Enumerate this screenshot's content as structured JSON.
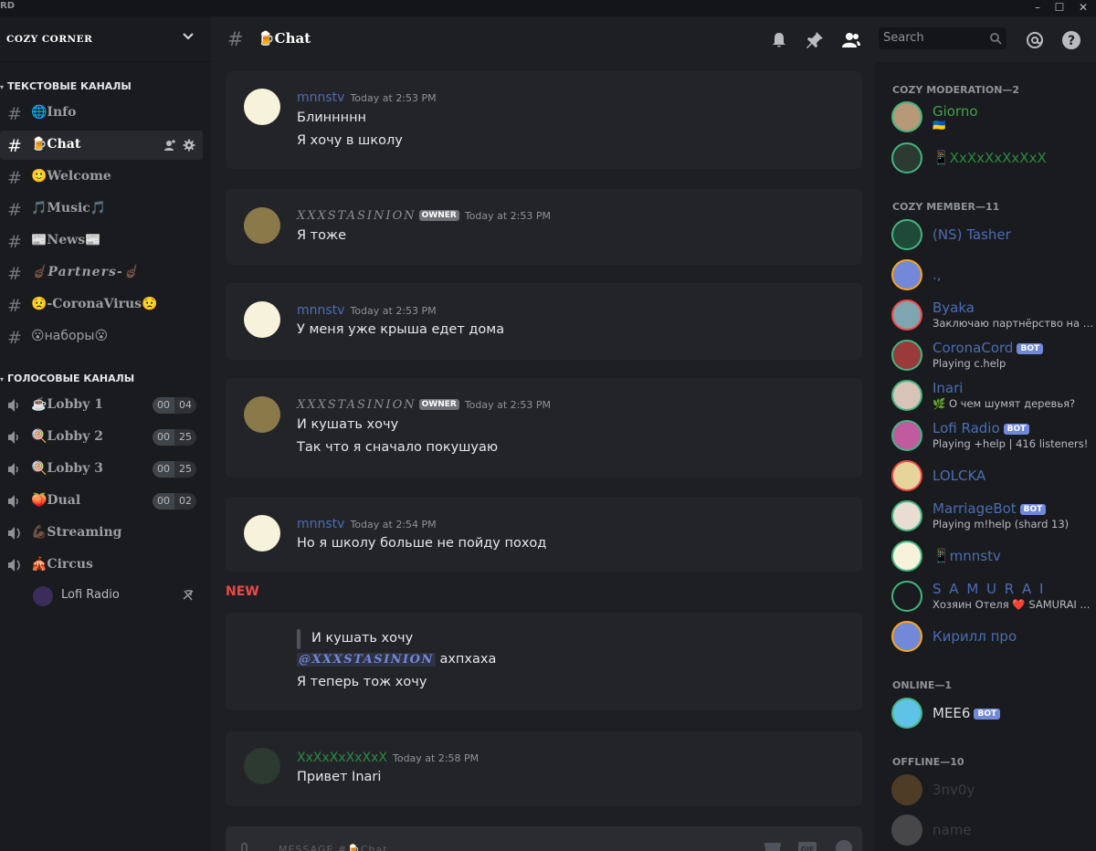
{
  "titlebar": {
    "brand": "RD"
  },
  "server": {
    "name": "COZY CORNER"
  },
  "sidebar": {
    "text_category": "ТЕКСТОВЫЕ КАНАЛЫ",
    "voice_category": "ГОЛОСОВЫЕ КАНАЛЫ",
    "text_channels": [
      {
        "label": "🌐Info"
      },
      {
        "label": "🍺Chat"
      },
      {
        "label": "🙂Welcome"
      },
      {
        "label": "🎵Music🎵"
      },
      {
        "label": "📰News📰"
      },
      {
        "label": "☝🏿Partners-☝🏿"
      },
      {
        "label": "😟-CoronaVirus😟"
      },
      {
        "label": "😮наборы😮"
      }
    ],
    "voice_channels": [
      {
        "label": "☕Lobby 1",
        "count_a": "00",
        "count_b": "04"
      },
      {
        "label": "🍭Lobby 2",
        "count_a": "00",
        "count_b": "25"
      },
      {
        "label": "🍭Lobby 3",
        "count_a": "00",
        "count_b": "25"
      },
      {
        "label": "🍑Dual",
        "count_a": "00",
        "count_b": "02"
      },
      {
        "label": "💪🏿Streaming"
      },
      {
        "label": "🎪Circus"
      }
    ],
    "voice_user": "Lofi Radio"
  },
  "header": {
    "channel": "🍺Chat",
    "search_placeholder": "Search"
  },
  "messages": [
    {
      "user": "mnnstv",
      "time": "Today at 2:53 PM",
      "lines": [
        "Блиннннн",
        "Я хочу в школу"
      ]
    },
    {
      "user": "XXXSTASINION",
      "badge": "OWNER",
      "time": "Today at 2:53 PM",
      "lines": [
        "Я тоже"
      ]
    },
    {
      "user": "mnnstv",
      "time": "Today at 2:53 PM",
      "lines": [
        "У меня уже крыша едет дома"
      ]
    },
    {
      "user": "XXXSTASINION",
      "badge": "OWNER",
      "time": "Today at 2:53 PM",
      "lines": [
        "И кушать хочу",
        "Так что я сначало покушуаю"
      ]
    },
    {
      "user": "mnnstv",
      "time": "Today at 2:54 PM",
      "lines": [
        "Но я школу больше не пойду поход"
      ]
    },
    {
      "quote": "И кушать хочу",
      "mention": "@XXXSTASINION",
      "after_mention": "ахпхаха",
      "lines": [
        "Я теперь тож хочу"
      ]
    },
    {
      "user": "XxXxXxXxXxX",
      "time": "Today at 2:58 PM",
      "lines": [
        "Привет Inari"
      ]
    }
  ],
  "new_divider": "NEW",
  "composer": {
    "placeholder": "MESSAGE #🍺Chat"
  },
  "members": {
    "groups": [
      {
        "title": "COZY MODERATION—2"
      },
      {
        "title": "COZY MEMBER—11"
      },
      {
        "title": "ONLINE—1"
      },
      {
        "title": "OFFLINE—10"
      }
    ],
    "list": [
      {
        "name": "Giorno",
        "status": "🇺🇦"
      },
      {
        "name": "📱XxXxXxXxXxX"
      },
      {
        "name": "(NS) Tasher"
      },
      {
        "name": ".,"
      },
      {
        "name": "Byaka",
        "status": "Заключаю партнёрство на с..."
      },
      {
        "name": "CoronaCord",
        "bot": "BOT",
        "status": "Playing c.help"
      },
      {
        "name": "Inari",
        "status": "🌿 О чем шумят деревья?"
      },
      {
        "name": "Lofi Radio",
        "bot": "BOT",
        "status": "Playing +help | 416 listeners!"
      },
      {
        "name": "LOLCKA"
      },
      {
        "name": "MarriageBot",
        "bot": "BOT",
        "status": "Playing m!help (shard 13)"
      },
      {
        "name": "📱mnnstv"
      },
      {
        "name": "S A M U R A I",
        "status": "Хозяин Отеля ❤️ SAMURAI ..."
      },
      {
        "name": "Кирилл про"
      },
      {
        "name": "MEE6",
        "bot": "BOT"
      },
      {
        "name": "3nv0y"
      },
      {
        "name": "name"
      }
    ]
  },
  "colors": {
    "accent": "#7289da",
    "online": "#43b581",
    "dnd": "#f04747",
    "idle": "#faa61a",
    "owner_name": "#8c8f94",
    "member_name": "#4a6db5",
    "new": "#f04747"
  }
}
